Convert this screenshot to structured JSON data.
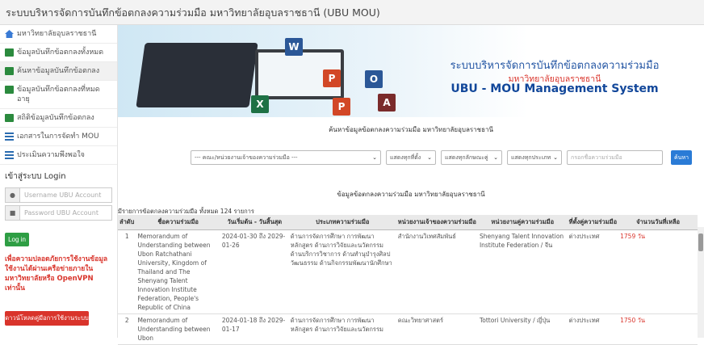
{
  "window": {
    "title": "ระบบบริหารจัดการบันทึกข้อตกลงความร่วมมือ มหาวิทยาลัยอุบลราชธานี (UBU MOU)"
  },
  "sidebar": {
    "items": [
      {
        "label": "มหาวิทยาลัยอุบลราชธานี",
        "icon": "home-icon"
      },
      {
        "label": "ข้อมูลบันทึกข้อตกลงทั้งหมด",
        "icon": "calendar-icon"
      },
      {
        "label": "ค้นหาข้อมูลบันทึกข้อตกลง",
        "icon": "calendar-icon"
      },
      {
        "label": "ข้อมูลบันทึกข้อตกลงที่หมดอายุ",
        "icon": "calendar-icon"
      },
      {
        "label": "สถิติข้อมูลบันทึกข้อตกลง",
        "icon": "calendar-icon"
      },
      {
        "label": "เอกสารในการจัดทำ MOU",
        "icon": "list-icon"
      },
      {
        "label": "ประเมินความพึงพอใจ",
        "icon": "list-icon"
      }
    ],
    "login": {
      "title": "เข้าสู่ระบบ Login",
      "username_placeholder": "Username UBU Account",
      "password_placeholder": "Password UBU Account",
      "login_label": "Log in",
      "warning": "เพื่อความปลอดภัยการใช้งานข้อมูล ใช้งานได้ผ่านเครือข่ายภายในมหาวิทยาลัยหรือ OpenVPN เท่านั้น",
      "manual_label": "ดาวน์โหลดคู่มือการใช้งานระบบ"
    }
  },
  "banner": {
    "title_th": "ระบบบริหารจัดการบันทึกข้อตกลงความร่วมมือ",
    "university": "มหาวิทยาลัยอุบลราชธานี",
    "title_en": "UBU - MOU Management System"
  },
  "search": {
    "title": "ค้นหาข้อมูลข้อตกลงความร่วมมือ มหาวิทยาลัยอุบลราชธานี",
    "agency_select": "--- คณะ/หน่วยงานเจ้าของความร่วมมือ ---",
    "status_select": "แสดงทุกที่ตั้ง",
    "type_select": "แสดงทุกลักษณะคู่",
    "country_select": "แสดงทุกประเภท",
    "keyword_placeholder": "กรอกชื่อความร่วมมือ",
    "search_label": "ค้นหา"
  },
  "results": {
    "title": "ข้อมูลข้อตกลงความร่วมมือ มหาวิทยาลัยอุบลราชธานี",
    "count_text": "มีรายการข้อตกลงความร่วมมือ ทั้งหมด 124 รายการ",
    "columns": [
      "ลำดับ",
      "ชื่อความร่วมมือ",
      "วันเริ่มต้น - วันสิ้นสุด",
      "ประเภทความร่วมมือ",
      "หน่วยงานเจ้าของความร่วมมือ",
      "หน่วยงานคู่ความร่วมมือ",
      "ที่ตั้งคู่ความร่วมมือ",
      "จำนวนวันที่เหลือ"
    ],
    "rows": [
      {
        "no": "1",
        "name": "Memorandum of Understanding between Ubon Ratchathani University, Kingdom of Thailand and The Shenyang Talent Innovation Institute Federation, People's Republic of China",
        "dates": "2024-01-30 ถึง 2029-01-26",
        "types": "ด้านการจัดการศึกษา การพัฒนาหลักสูตร ด้านการวิจัยและนวัตกรรม ด้านบริการวิชาการ ด้านทำนุบำรุงศิลปวัฒนธรรม ด้านกิจกรรมพัฒนานักศึกษา",
        "owner": "สำนักงานวิเทศสัมพันธ์",
        "partner": "Shenyang Talent Innovation Institute Federation / จีน",
        "location": "ต่างประเทศ",
        "days": "1759 วัน"
      },
      {
        "no": "2",
        "name": "Memorandum of Understanding between Ubon",
        "dates": "2024-01-18 ถึง 2029-01-17",
        "types": "ด้านการจัดการศึกษา การพัฒนาหลักสูตร ด้านการวิจัยและนวัตกรรม",
        "owner": "คณะวิทยาศาสตร์",
        "partner": "Tottori University / ญี่ปุ่น",
        "location": "ต่างประเทศ",
        "days": "1750 วัน"
      }
    ]
  }
}
